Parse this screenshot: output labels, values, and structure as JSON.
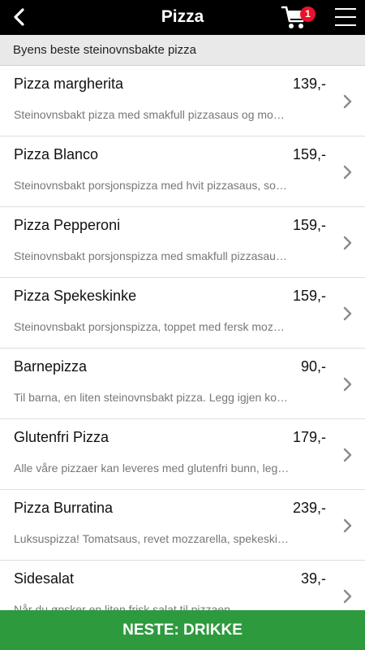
{
  "header": {
    "title": "Pizza",
    "back_icon": "chevron-left-icon",
    "cart_icon": "shopping-cart-icon",
    "cart_count": "1",
    "menu_icon": "hamburger-menu-icon"
  },
  "subheader": {
    "text": "Byens beste steinovnsbakte pizza"
  },
  "items": [
    {
      "name": "Pizza margherita",
      "price": "139,-",
      "description": "Steinovnsbakt pizza med smakfull pizzasaus og mozzarella"
    },
    {
      "name": "Pizza Blanco",
      "price": "159,-",
      "description": "Steinovnsbakt porsjonspizza med hvit pizzasaus, sopp og mozzarella"
    },
    {
      "name": "Pizza Pepperoni",
      "price": "159,-",
      "description": "Steinovnsbakt porsjonspizza med smakfull pizzasaus og pepperoni"
    },
    {
      "name": "Pizza Spekeskinke",
      "price": "159,-",
      "description": "Steinovnsbakt porsjonspizza, toppet med fersk mozzarella og spekeskinke"
    },
    {
      "name": "Barnepizza",
      "price": "90,-",
      "description": "Til barna, en liten steinovnsbakt pizza. Legg igjen kommentar"
    },
    {
      "name": "Glutenfri Pizza",
      "price": "179,-",
      "description": "Alle våre pizzaer kan leveres med glutenfri bunn, legg inn kommentar"
    },
    {
      "name": "Pizza Burratina",
      "price": "239,-",
      "description": "Luksuspizza! Tomatsaus, revet mozzarella, spekeskinke og burrata"
    },
    {
      "name": "Sidesalat",
      "price": "39,-",
      "description": "Når du ønsker en liten frisk salat til pizzaen"
    }
  ],
  "footer": {
    "next_label": "NESTE: DRIKKE"
  },
  "colors": {
    "topbar": "#000000",
    "badge": "#e8132a",
    "cart_icon": "#ffffff",
    "next_button": "#2e9a3e",
    "subheader_bg": "#e9e9e9",
    "chevron": "#8a8a8a"
  }
}
